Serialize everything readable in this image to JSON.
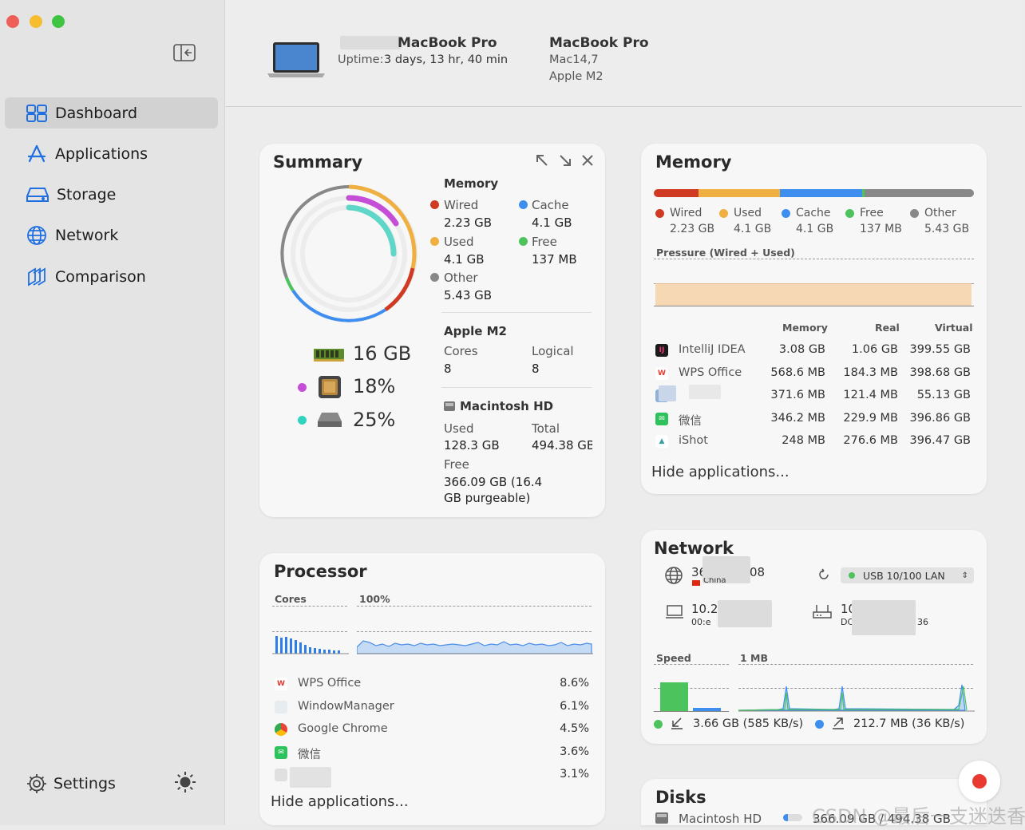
{
  "sidebar": {
    "items": [
      {
        "label": "Dashboard",
        "icon": "dashboard-icon"
      },
      {
        "label": "Applications",
        "icon": "applications-icon"
      },
      {
        "label": "Storage",
        "icon": "storage-icon"
      },
      {
        "label": "Network",
        "icon": "network-icon"
      },
      {
        "label": "Comparison",
        "icon": "comparison-icon"
      }
    ],
    "settings_label": "Settings"
  },
  "header": {
    "device_name": "MacBook Pro",
    "uptime_label": "Uptime:",
    "uptime_value": "3 days, 13 hr, 40 min",
    "model_title": "MacBook Pro",
    "model_id": "Mac14,7",
    "chip": "Apple M2"
  },
  "summary": {
    "title": "Summary",
    "memory_heading": "Memory",
    "wired_label": "Wired",
    "wired_value": "2.23 GB",
    "cache_label": "Cache",
    "cache_value": "4.1 GB",
    "used_label": "Used",
    "used_value": "4.1 GB",
    "free_label": "Free",
    "free_value": "137 MB",
    "other_label": "Other",
    "other_value": "5.43 GB",
    "chip_heading": "Apple M2",
    "cores_label": "Cores",
    "cores_value": "8",
    "logical_label": "Logical",
    "logical_value": "8",
    "disk_heading": "Macintosh HD",
    "disk_used_label": "Used",
    "disk_used_value": "128.3 GB",
    "disk_total_label": "Total",
    "disk_total_value": "494.38 GB",
    "disk_free_label": "Free",
    "disk_free_value_line1": "366.09 GB (16.4",
    "disk_free_value_line2": "GB purgeable)",
    "ram_total": "16 GB",
    "cpu_usage": "18%",
    "disk_usage": "25%"
  },
  "memory": {
    "title": "Memory",
    "legend": [
      {
        "label": "Wired",
        "value": "2.23 GB",
        "color": "#d03a22"
      },
      {
        "label": "Used",
        "value": "4.1 GB",
        "color": "#f0b041"
      },
      {
        "label": "Cache",
        "value": "4.1 GB",
        "color": "#3e8ef0"
      },
      {
        "label": "Free",
        "value": "137 MB",
        "color": "#4cc35c"
      },
      {
        "label": "Other",
        "value": "5.43 GB",
        "color": "#888888"
      }
    ],
    "pressure_label": "Pressure (Wired + Used)",
    "col_memory": "Memory",
    "col_real": "Real",
    "col_virtual": "Virtual",
    "apps": [
      {
        "name": "IntelliJ IDEA",
        "memory": "3.08 GB",
        "real": "1.06 GB",
        "virtual": "399.55 GB"
      },
      {
        "name": "WPS Office",
        "memory": "568.6 MB",
        "real": "184.3 MB",
        "virtual": "398.68 GB"
      },
      {
        "name": "",
        "memory": "371.6 MB",
        "real": "121.4 MB",
        "virtual": "55.13 GB"
      },
      {
        "name": "微信",
        "memory": "346.2 MB",
        "real": "229.9 MB",
        "virtual": "396.86 GB"
      },
      {
        "name": "iShot",
        "memory": "248 MB",
        "real": "276.6 MB",
        "virtual": "396.47 GB"
      }
    ],
    "hide_label": "Hide applications..."
  },
  "processor": {
    "title": "Processor",
    "cores_label": "Cores",
    "pct_label": "100%",
    "apps": [
      {
        "name": "WPS Office",
        "pct": "8.6%"
      },
      {
        "name": "WindowManager",
        "pct": "6.1%"
      },
      {
        "name": "Google Chrome",
        "pct": "4.5%"
      },
      {
        "name": "微信",
        "pct": "3.6%"
      },
      {
        "name": "",
        "pct": "3.1%"
      }
    ],
    "hide_label": "Hide applications..."
  },
  "network": {
    "title": "Network",
    "ip_prefix": "36",
    "ip_suffix": "08",
    "country": "China",
    "interface": "USB 10/100 LAN",
    "local_ip_prefix": "10.2",
    "mac_prefix": "00:e",
    "router_prefix": "10",
    "router_sub": "DC",
    "router_tail": "36",
    "speed_label": "Speed",
    "scale_label": "1 MB",
    "download": "3.66 GB (585 KB/s)",
    "upload": "212.7 MB (36 KB/s)"
  },
  "disks": {
    "title": "Disks",
    "name": "Macintosh HD",
    "usage": "366.09 GB / 494.38 GB"
  },
  "watermark": "CSDN @最后一支迷迭香"
}
